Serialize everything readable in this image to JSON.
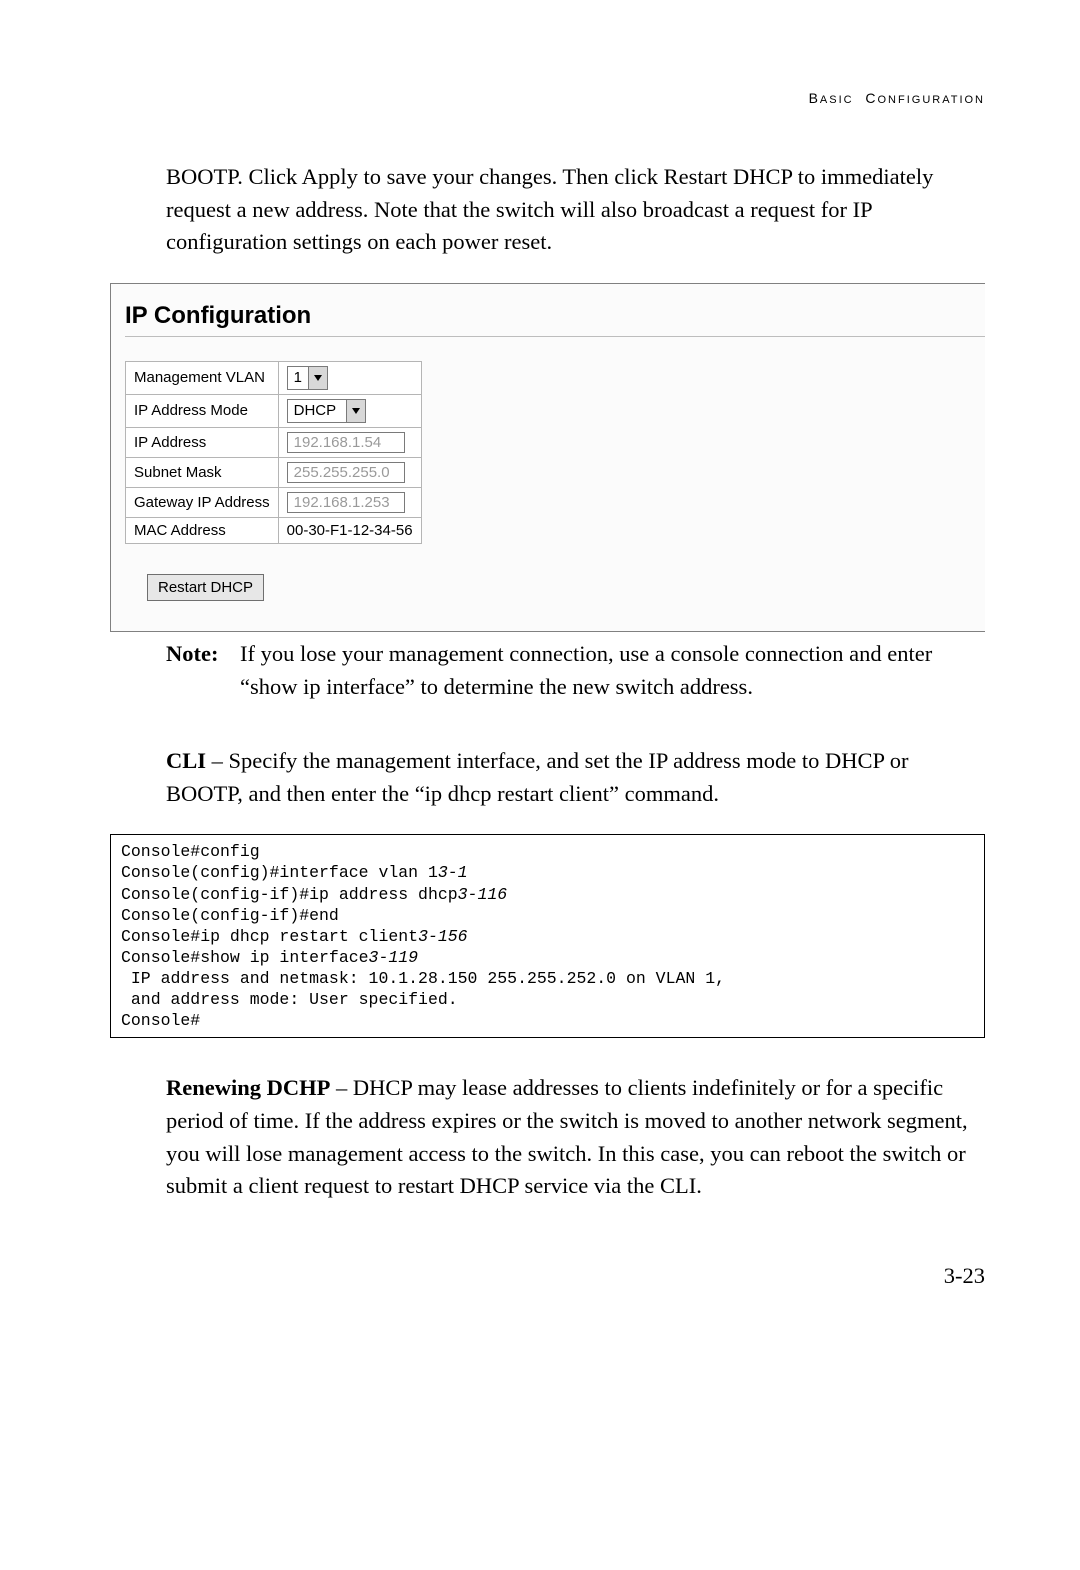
{
  "header": {
    "text": "BASIC CONFIGURATION"
  },
  "p1": "BOOTP. Click Apply to save your changes. Then click Restart DHCP to immediately request a new address. Note that the switch will also broadcast a request for IP configuration settings on each power reset.",
  "panel": {
    "title": "IP Configuration",
    "rows": {
      "mgmt_vlan": {
        "label": "Management VLAN",
        "value": "1"
      },
      "ip_mode": {
        "label": "IP Address Mode",
        "value": "DHCP"
      },
      "ip_addr": {
        "label": "IP Address",
        "value": "192.168.1.54"
      },
      "subnet": {
        "label": "Subnet Mask",
        "value": "255.255.255.0"
      },
      "gateway": {
        "label": "Gateway IP Address",
        "value": "192.168.1.253"
      },
      "mac": {
        "label": "MAC Address",
        "value": "00-30-F1-12-34-56"
      }
    },
    "button": "Restart DHCP"
  },
  "note": {
    "label": "Note:",
    "text": "If you lose your management connection, use a console connection and enter “show ip interface” to determine the new switch address."
  },
  "cli_intro": {
    "bold": "CLI",
    "rest": " – Specify the management interface, and set the IP address mode to DHCP or BOOTP, and then enter the “ip dhcp restart client” command."
  },
  "cli": {
    "l1": "Console#config",
    "l2a": "Console(config)#interface vlan 1",
    "l2b": "3-1",
    "l3a": "Console(config-if)#ip address dhcp",
    "l3b": "3-116",
    "l4": "Console(config-if)#end",
    "l5a": "Console#ip dhcp restart client",
    "l5b": "3-156",
    "l6a": "Console#show ip interface",
    "l6b": "3-119",
    "l7": " IP address and netmask: 10.1.28.150 255.255.252.0 on VLAN 1,",
    "l8": " and address mode: User specified.",
    "l9": "Console#"
  },
  "renew": {
    "bold": "Renewing DCHP",
    "rest": " – DHCP may lease addresses to clients indefinitely or for a specific period of time. If the address expires or the switch is moved to another network segment, you will lose management access to the switch. In this case, you can reboot the switch or submit a client request to restart DHCP service via the CLI."
  },
  "page_number": "3-23"
}
